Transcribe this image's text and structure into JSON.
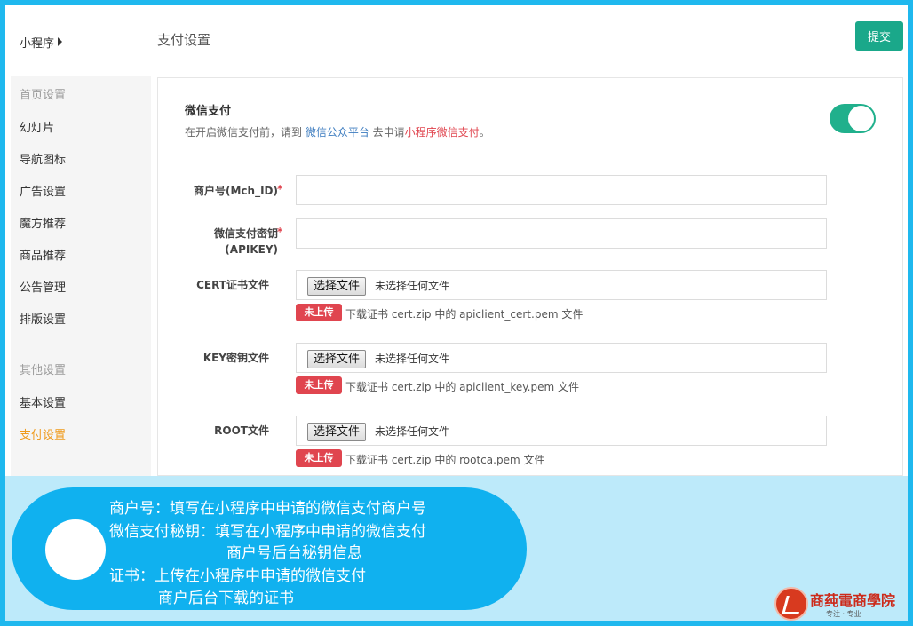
{
  "sidebar": {
    "app_title": "小程序",
    "group_home": "首页设置",
    "home_items": [
      {
        "label": "幻灯片"
      },
      {
        "label": "导航图标"
      },
      {
        "label": "广告设置"
      },
      {
        "label": "魔方推荐"
      },
      {
        "label": "商品推荐"
      },
      {
        "label": "公告管理"
      },
      {
        "label": "排版设置"
      }
    ],
    "group_other": "其他设置",
    "other_items": [
      {
        "label": "基本设置"
      },
      {
        "label": "支付设置"
      }
    ],
    "active_item": "支付设置"
  },
  "header": {
    "page_title": "支付设置",
    "submit_label": "提交"
  },
  "wechat_pay": {
    "title": "微信支付",
    "desc_prefix": "在开启微信支付前，请到 ",
    "desc_link": "微信公众平台",
    "desc_middle": " 去申请",
    "desc_red": "小程序微信支付",
    "desc_suffix": "。",
    "enabled": true
  },
  "form": {
    "mch_id_label": "商户号(Mch_ID)",
    "apikey_label_line1": "微信支付密钥",
    "apikey_label_line2": "(APIKEY)",
    "required_mark": "*",
    "mch_id_value": "",
    "apikey_value": "",
    "cert": {
      "label": "CERT证书文件",
      "button": "选择文件",
      "status": "未选择任何文件",
      "badge": "未上传",
      "hint": "下载证书 cert.zip 中的 apiclient_cert.pem 文件"
    },
    "key": {
      "label": "KEY密钥文件",
      "button": "选择文件",
      "status": "未选择任何文件",
      "badge": "未上传",
      "hint": "下载证书 cert.zip 中的 apiclient_key.pem 文件"
    },
    "root": {
      "label": "ROOT文件",
      "button": "选择文件",
      "status": "未选择任何文件",
      "badge": "未上传",
      "hint": "下载证书 cert.zip 中的 rootca.pem 文件"
    }
  },
  "annotation": {
    "line1": "商户号：填写在小程序中申请的微信支付商户号",
    "line2": "微信支付秘钥：填写在小程序中申请的微信支付",
    "line3": "商户号后台秘钥信息",
    "line4": "证书：上传在小程序中申请的微信支付",
    "line5": "商户后台下载的证书"
  },
  "brand": {
    "name": "商莼電商學院",
    "tagline": "专注 · 专业"
  },
  "colors": {
    "accent_green": "#1aa88a",
    "active_orange": "#ef9a1c",
    "badge_red": "#e0454f",
    "link_blue": "#3b7bbf",
    "background_blue": "#1fb8ee"
  }
}
